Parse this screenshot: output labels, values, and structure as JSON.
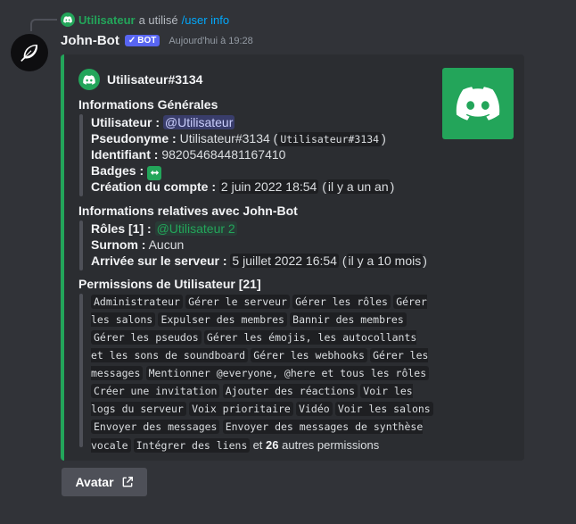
{
  "reply": {
    "username": "Utilisateur",
    "used_text": "a utilisé",
    "command": "/user info"
  },
  "message": {
    "author": "John-Bot",
    "bot_badge": "BOT",
    "timestamp": "Aujourd'hui à 19:28"
  },
  "embed": {
    "accent_color": "#23a55a",
    "author_name": "Utilisateur#3134",
    "general": {
      "title": "Informations Générales",
      "user_label": "Utilisateur :",
      "user_value": "@Utilisateur",
      "nickname_label": "Pseudonyme :",
      "nickname_value": "Utilisateur#3134",
      "nickname_code": "Utilisateur#3134",
      "id_label": "Identifiant :",
      "id_value": "982054684481167410",
      "badges_label": "Badges :",
      "created_label": "Création du compte :",
      "created_date": "2 juin 2022 18:54",
      "created_rel": "il y a un an"
    },
    "relative": {
      "title": "Informations relatives avec John-Bot",
      "roles_label": "Rôles [1] :",
      "roles_value": "@Utilisateur 2",
      "nick_label": "Surnom :",
      "nick_value": "Aucun",
      "joined_label": "Arrivée sur le serveur :",
      "joined_date": "5 juillet 2022 16:54",
      "joined_rel": "il y a 10 mois"
    },
    "permissions": {
      "title": "Permissions de Utilisateur [21]",
      "items": [
        "Administrateur",
        "Gérer le serveur",
        "Gérer les rôles",
        "Gérer les salons",
        "Expulser des membres",
        "Bannir des membres",
        "Gérer les pseudos",
        "Gérer les émojis, les autocollants et les sons de soundboard",
        "Gérer les webhooks",
        "Gérer les messages",
        "Mentionner @everyone, @here et tous les rôles",
        "Créer une invitation",
        "Ajouter des réactions",
        "Voir les logs du serveur",
        "Voix prioritaire",
        "Vidéo",
        "Voir les salons",
        "Envoyer des messages",
        "Envoyer des messages de synthèse vocale",
        "Intégrer des liens"
      ],
      "more_prefix": "et",
      "more_count": "26",
      "more_suffix": "autres permissions"
    }
  },
  "button": {
    "label": "Avatar"
  },
  "icons": {
    "avatar": "feather-icon",
    "embed_author": "discord-icon",
    "thumbnail": "discord-logo",
    "button": "external-link-icon"
  }
}
